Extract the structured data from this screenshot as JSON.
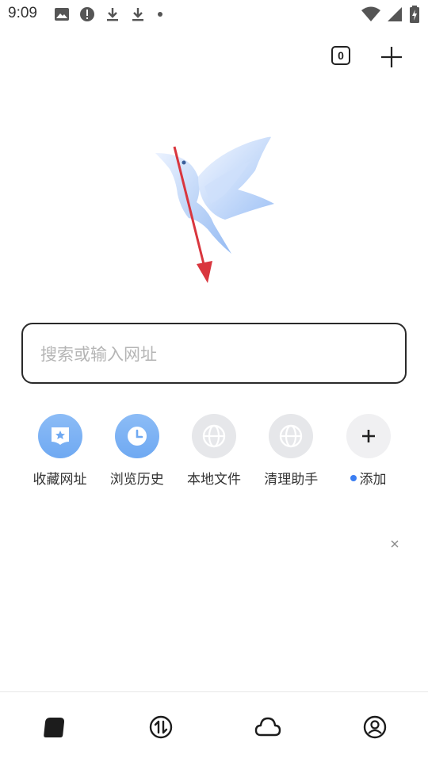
{
  "status_bar": {
    "time": "9:09",
    "left_icons": [
      "image-icon",
      "alert-icon",
      "download-icon",
      "download-icon",
      "dot-icon"
    ],
    "right_icons": [
      "wifi-icon",
      "signal-icon",
      "battery-icon"
    ]
  },
  "header": {
    "tab_count": "0"
  },
  "search": {
    "placeholder": "搜索或输入网址"
  },
  "shortcuts": [
    {
      "label": "收藏网址",
      "icon": "bookmark-icon"
    },
    {
      "label": "浏览历史",
      "icon": "history-icon"
    },
    {
      "label": "本地文件",
      "icon": "globe-icon"
    },
    {
      "label": "清理助手",
      "icon": "globe-icon"
    },
    {
      "label": "添加",
      "icon": "plus-icon"
    }
  ],
  "bottom_nav": [
    {
      "name": "home",
      "icon": "home-icon"
    },
    {
      "name": "transfer",
      "icon": "transfer-icon"
    },
    {
      "name": "cloud",
      "icon": "cloud-icon"
    },
    {
      "name": "profile",
      "icon": "profile-icon"
    }
  ],
  "colors": {
    "accent": "#6fa9f2",
    "dot": "#3b7ef2",
    "arrow": "#d9363e"
  }
}
